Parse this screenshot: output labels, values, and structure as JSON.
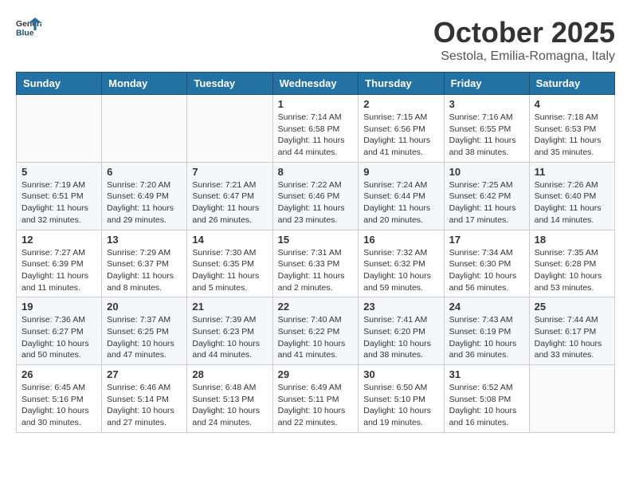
{
  "header": {
    "logo_general": "General",
    "logo_blue": "Blue",
    "month": "October 2025",
    "location": "Sestola, Emilia-Romagna, Italy"
  },
  "days_of_week": [
    "Sunday",
    "Monday",
    "Tuesday",
    "Wednesday",
    "Thursday",
    "Friday",
    "Saturday"
  ],
  "weeks": [
    [
      {
        "day": "",
        "info": ""
      },
      {
        "day": "",
        "info": ""
      },
      {
        "day": "",
        "info": ""
      },
      {
        "day": "1",
        "info": "Sunrise: 7:14 AM\nSunset: 6:58 PM\nDaylight: 11 hours and 44 minutes."
      },
      {
        "day": "2",
        "info": "Sunrise: 7:15 AM\nSunset: 6:56 PM\nDaylight: 11 hours and 41 minutes."
      },
      {
        "day": "3",
        "info": "Sunrise: 7:16 AM\nSunset: 6:55 PM\nDaylight: 11 hours and 38 minutes."
      },
      {
        "day": "4",
        "info": "Sunrise: 7:18 AM\nSunset: 6:53 PM\nDaylight: 11 hours and 35 minutes."
      }
    ],
    [
      {
        "day": "5",
        "info": "Sunrise: 7:19 AM\nSunset: 6:51 PM\nDaylight: 11 hours and 32 minutes."
      },
      {
        "day": "6",
        "info": "Sunrise: 7:20 AM\nSunset: 6:49 PM\nDaylight: 11 hours and 29 minutes."
      },
      {
        "day": "7",
        "info": "Sunrise: 7:21 AM\nSunset: 6:47 PM\nDaylight: 11 hours and 26 minutes."
      },
      {
        "day": "8",
        "info": "Sunrise: 7:22 AM\nSunset: 6:46 PM\nDaylight: 11 hours and 23 minutes."
      },
      {
        "day": "9",
        "info": "Sunrise: 7:24 AM\nSunset: 6:44 PM\nDaylight: 11 hours and 20 minutes."
      },
      {
        "day": "10",
        "info": "Sunrise: 7:25 AM\nSunset: 6:42 PM\nDaylight: 11 hours and 17 minutes."
      },
      {
        "day": "11",
        "info": "Sunrise: 7:26 AM\nSunset: 6:40 PM\nDaylight: 11 hours and 14 minutes."
      }
    ],
    [
      {
        "day": "12",
        "info": "Sunrise: 7:27 AM\nSunset: 6:39 PM\nDaylight: 11 hours and 11 minutes."
      },
      {
        "day": "13",
        "info": "Sunrise: 7:29 AM\nSunset: 6:37 PM\nDaylight: 11 hours and 8 minutes."
      },
      {
        "day": "14",
        "info": "Sunrise: 7:30 AM\nSunset: 6:35 PM\nDaylight: 11 hours and 5 minutes."
      },
      {
        "day": "15",
        "info": "Sunrise: 7:31 AM\nSunset: 6:33 PM\nDaylight: 11 hours and 2 minutes."
      },
      {
        "day": "16",
        "info": "Sunrise: 7:32 AM\nSunset: 6:32 PM\nDaylight: 10 hours and 59 minutes."
      },
      {
        "day": "17",
        "info": "Sunrise: 7:34 AM\nSunset: 6:30 PM\nDaylight: 10 hours and 56 minutes."
      },
      {
        "day": "18",
        "info": "Sunrise: 7:35 AM\nSunset: 6:28 PM\nDaylight: 10 hours and 53 minutes."
      }
    ],
    [
      {
        "day": "19",
        "info": "Sunrise: 7:36 AM\nSunset: 6:27 PM\nDaylight: 10 hours and 50 minutes."
      },
      {
        "day": "20",
        "info": "Sunrise: 7:37 AM\nSunset: 6:25 PM\nDaylight: 10 hours and 47 minutes."
      },
      {
        "day": "21",
        "info": "Sunrise: 7:39 AM\nSunset: 6:23 PM\nDaylight: 10 hours and 44 minutes."
      },
      {
        "day": "22",
        "info": "Sunrise: 7:40 AM\nSunset: 6:22 PM\nDaylight: 10 hours and 41 minutes."
      },
      {
        "day": "23",
        "info": "Sunrise: 7:41 AM\nSunset: 6:20 PM\nDaylight: 10 hours and 38 minutes."
      },
      {
        "day": "24",
        "info": "Sunrise: 7:43 AM\nSunset: 6:19 PM\nDaylight: 10 hours and 36 minutes."
      },
      {
        "day": "25",
        "info": "Sunrise: 7:44 AM\nSunset: 6:17 PM\nDaylight: 10 hours and 33 minutes."
      }
    ],
    [
      {
        "day": "26",
        "info": "Sunrise: 6:45 AM\nSunset: 5:16 PM\nDaylight: 10 hours and 30 minutes."
      },
      {
        "day": "27",
        "info": "Sunrise: 6:46 AM\nSunset: 5:14 PM\nDaylight: 10 hours and 27 minutes."
      },
      {
        "day": "28",
        "info": "Sunrise: 6:48 AM\nSunset: 5:13 PM\nDaylight: 10 hours and 24 minutes."
      },
      {
        "day": "29",
        "info": "Sunrise: 6:49 AM\nSunset: 5:11 PM\nDaylight: 10 hours and 22 minutes."
      },
      {
        "day": "30",
        "info": "Sunrise: 6:50 AM\nSunset: 5:10 PM\nDaylight: 10 hours and 19 minutes."
      },
      {
        "day": "31",
        "info": "Sunrise: 6:52 AM\nSunset: 5:08 PM\nDaylight: 10 hours and 16 minutes."
      },
      {
        "day": "",
        "info": ""
      }
    ]
  ]
}
